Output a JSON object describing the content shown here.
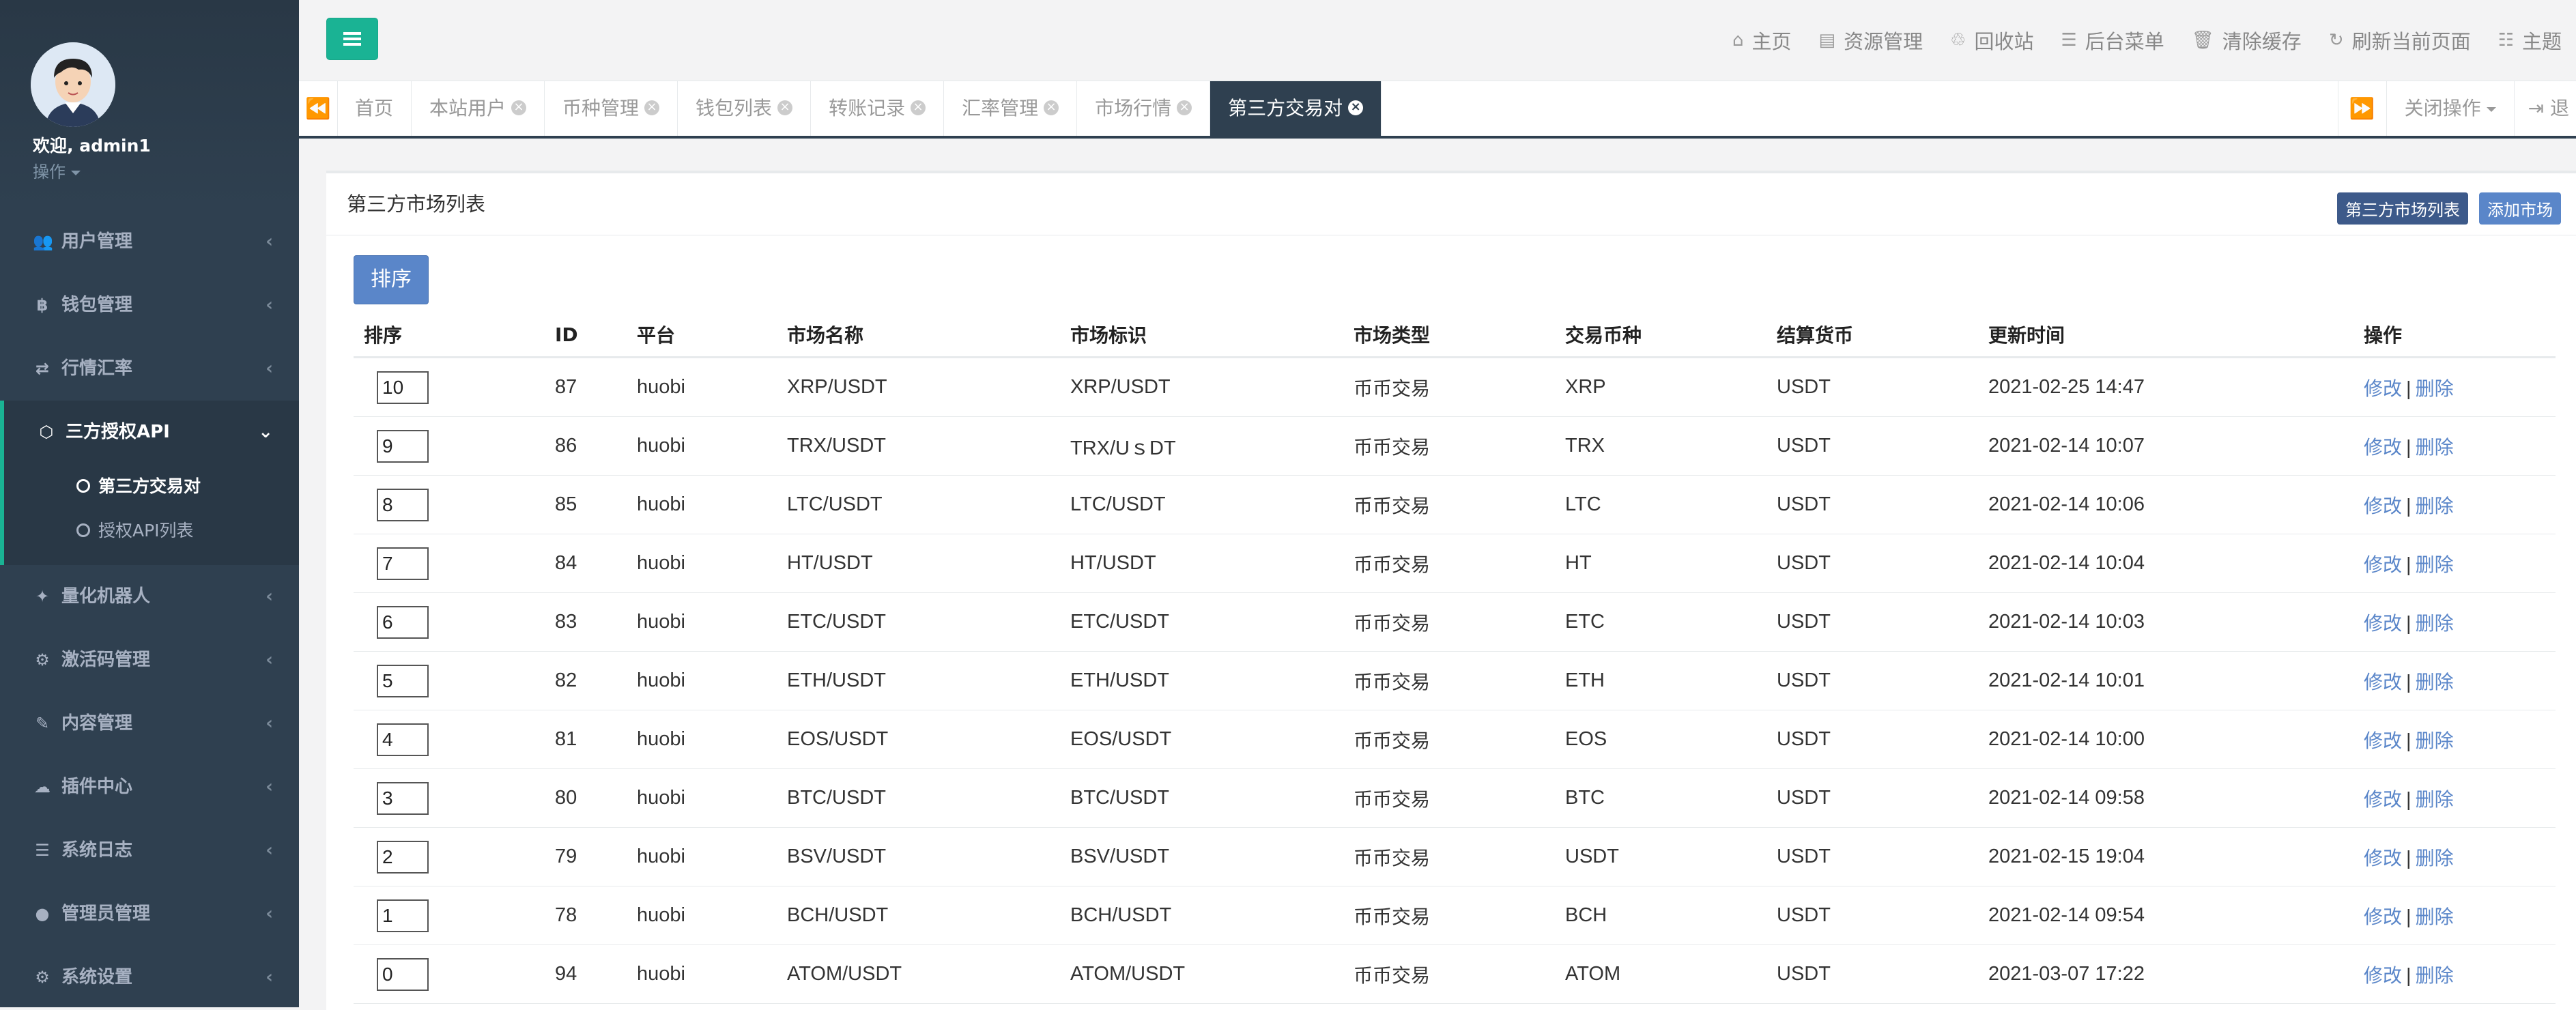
{
  "sidebar": {
    "welcome": "欢迎, admin1",
    "ops_label": "操作",
    "menu": [
      {
        "label": "用户管理",
        "icon": "users-icon"
      },
      {
        "label": "钱包管理",
        "icon": "bitcoin-icon"
      },
      {
        "label": "行情汇率",
        "icon": "exchange-icon"
      },
      {
        "label": "三方授权API",
        "icon": "cube-icon"
      },
      {
        "label": "量化机器人",
        "icon": "robot-icon"
      },
      {
        "label": "激活码管理",
        "icon": "cog-icon"
      },
      {
        "label": "内容管理",
        "icon": "edit-icon"
      },
      {
        "label": "插件中心",
        "icon": "cloud-icon"
      },
      {
        "label": "系统日志",
        "icon": "database-icon"
      },
      {
        "label": "管理员管理",
        "icon": "user-shield-icon"
      },
      {
        "label": "系统设置",
        "icon": "cogs-icon"
      }
    ],
    "submenu": [
      {
        "label": "第三方交易对"
      },
      {
        "label": "授权API列表"
      }
    ]
  },
  "topbar": {
    "links": [
      {
        "label": "主页",
        "icon": "home-icon"
      },
      {
        "label": "资源管理",
        "icon": "file-icon"
      },
      {
        "label": "回收站",
        "icon": "recycle-icon"
      },
      {
        "label": "后台菜单",
        "icon": "list-icon"
      },
      {
        "label": "清除缓存",
        "icon": "trash-icon"
      },
      {
        "label": "刷新当前页面",
        "icon": "refresh-icon"
      },
      {
        "label": "主题",
        "icon": "theme-icon"
      }
    ]
  },
  "tabs": {
    "items": [
      {
        "label": "首页"
      },
      {
        "label": "本站用户"
      },
      {
        "label": "币种管理"
      },
      {
        "label": "钱包列表"
      },
      {
        "label": "转账记录"
      },
      {
        "label": "汇率管理"
      },
      {
        "label": "市场行情"
      },
      {
        "label": "第三方交易对"
      }
    ],
    "close_ops": "关闭操作",
    "exit_label": "退"
  },
  "panel": {
    "title": "第三方市场列表",
    "btn_list": "第三方市场列表",
    "btn_add": "添加市场",
    "sort_button": "排序"
  },
  "table": {
    "headers": [
      "排序",
      "ID",
      "平台",
      "市场名称",
      "市场标识",
      "市场类型",
      "交易币种",
      "结算货币",
      "更新时间",
      "操作"
    ],
    "edit_label": "修改",
    "delete_label": "删除",
    "rows": [
      {
        "sort": "10",
        "id": "87",
        "platform": "huobi",
        "name": "XRP/USDT",
        "symbol": "XRP/USDT",
        "type": "币币交易",
        "coin": "XRP",
        "settle": "USDT",
        "updated": "2021-02-25 14:47"
      },
      {
        "sort": "9",
        "id": "86",
        "platform": "huobi",
        "name": "TRX/USDT",
        "symbol": "TRX/UｓDT",
        "type": "币币交易",
        "coin": "TRX",
        "settle": "USDT",
        "updated": "2021-02-14 10:07"
      },
      {
        "sort": "8",
        "id": "85",
        "platform": "huobi",
        "name": "LTC/USDT",
        "symbol": "LTC/USDT",
        "type": "币币交易",
        "coin": "LTC",
        "settle": "USDT",
        "updated": "2021-02-14 10:06"
      },
      {
        "sort": "7",
        "id": "84",
        "platform": "huobi",
        "name": "HT/USDT",
        "symbol": "HT/USDT",
        "type": "币币交易",
        "coin": "HT",
        "settle": "USDT",
        "updated": "2021-02-14 10:04"
      },
      {
        "sort": "6",
        "id": "83",
        "platform": "huobi",
        "name": "ETC/USDT",
        "symbol": "ETC/USDT",
        "type": "币币交易",
        "coin": "ETC",
        "settle": "USDT",
        "updated": "2021-02-14 10:03"
      },
      {
        "sort": "5",
        "id": "82",
        "platform": "huobi",
        "name": "ETH/USDT",
        "symbol": "ETH/USDT",
        "type": "币币交易",
        "coin": "ETH",
        "settle": "USDT",
        "updated": "2021-02-14 10:01"
      },
      {
        "sort": "4",
        "id": "81",
        "platform": "huobi",
        "name": "EOS/USDT",
        "symbol": "EOS/USDT",
        "type": "币币交易",
        "coin": "EOS",
        "settle": "USDT",
        "updated": "2021-02-14 10:00"
      },
      {
        "sort": "3",
        "id": "80",
        "platform": "huobi",
        "name": "BTC/USDT",
        "symbol": "BTC/USDT",
        "type": "币币交易",
        "coin": "BTC",
        "settle": "USDT",
        "updated": "2021-02-14 09:58"
      },
      {
        "sort": "2",
        "id": "79",
        "platform": "huobi",
        "name": "BSV/USDT",
        "symbol": "BSV/USDT",
        "type": "币币交易",
        "coin": "USDT",
        "settle": "USDT",
        "updated": "2021-02-15 19:04"
      },
      {
        "sort": "1",
        "id": "78",
        "platform": "huobi",
        "name": "BCH/USDT",
        "symbol": "BCH/USDT",
        "type": "币币交易",
        "coin": "BCH",
        "settle": "USDT",
        "updated": "2021-02-14 09:54"
      },
      {
        "sort": "0",
        "id": "94",
        "platform": "huobi",
        "name": "ATOM/USDT",
        "symbol": "ATOM/USDT",
        "type": "币币交易",
        "coin": "ATOM",
        "settle": "USDT",
        "updated": "2021-03-07 17:22"
      }
    ]
  },
  "colors": {
    "sidebar_bg": "#2f4050",
    "accent_green": "#1ab394",
    "button_blue": "#5a86c9",
    "button_dark_blue": "#3d5a8a",
    "link_blue": "#5a86c9"
  }
}
